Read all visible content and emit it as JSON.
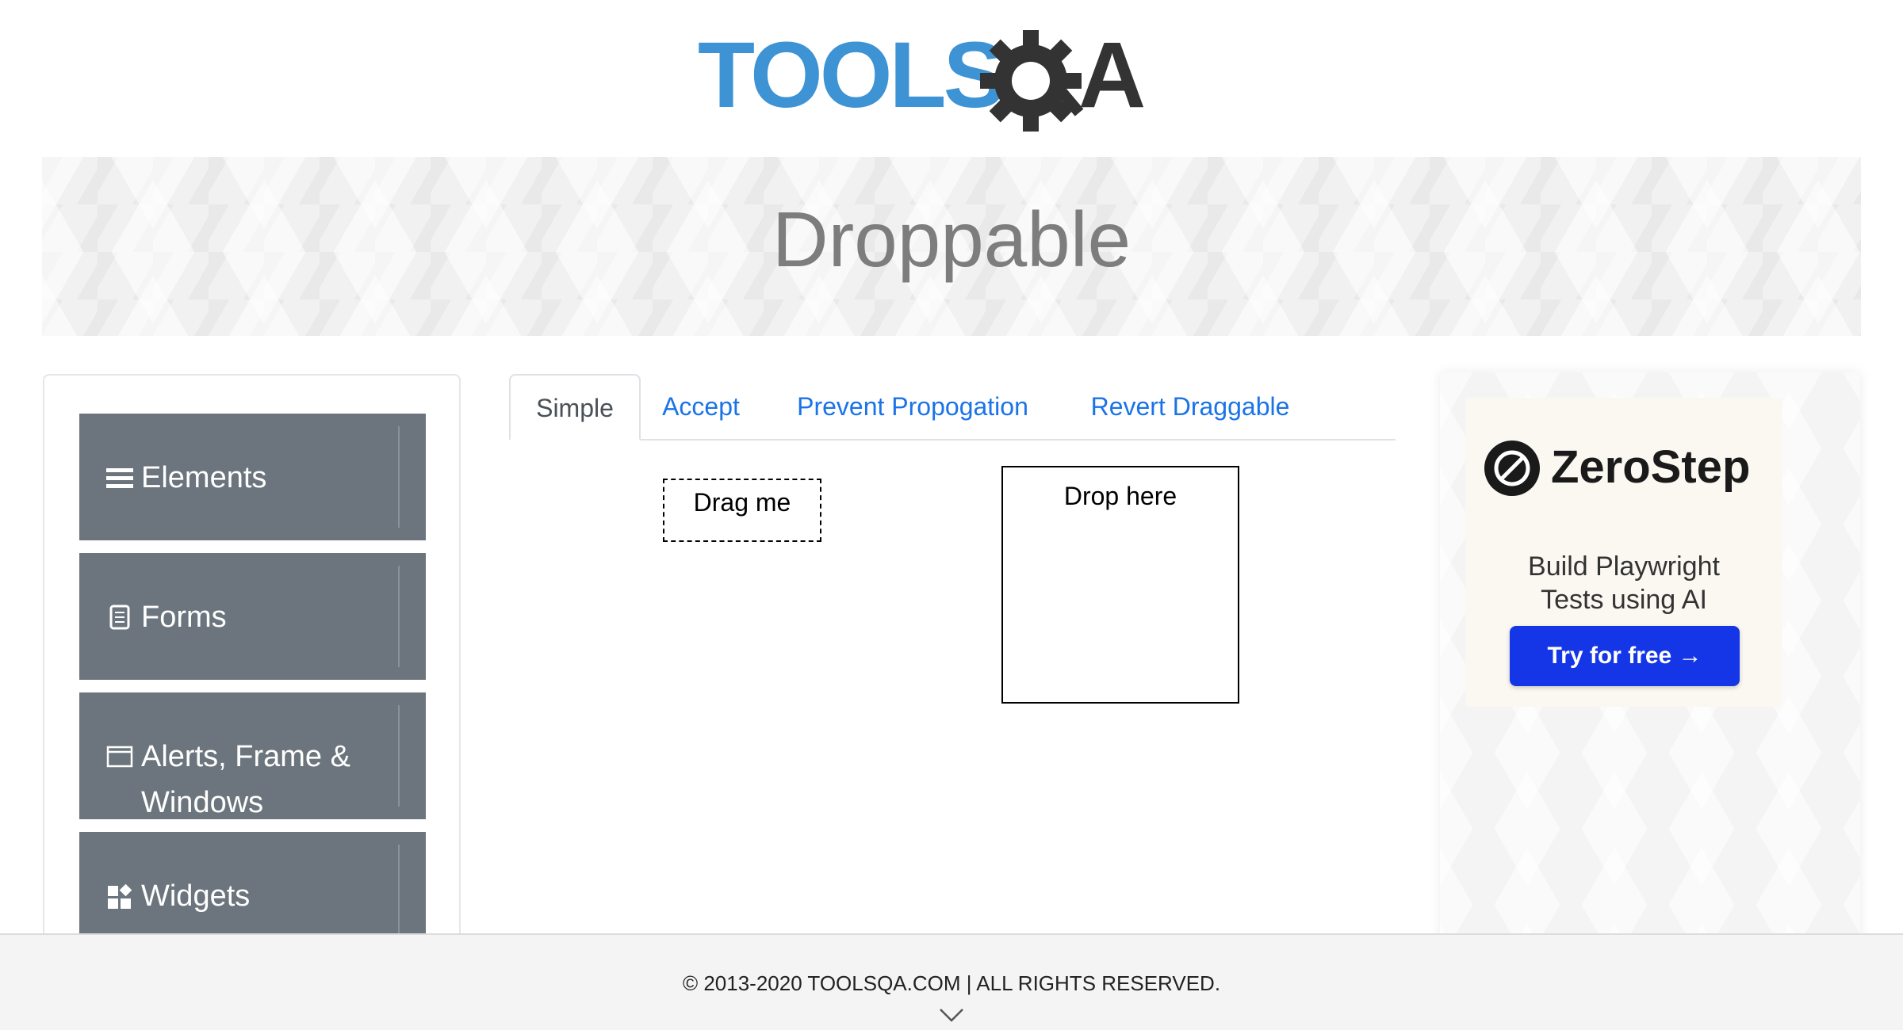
{
  "header": {
    "logo_text_1": "TOOLS",
    "logo_text_2": "QA"
  },
  "banner": {
    "title": "Droppable"
  },
  "sidebar": {
    "groups": [
      {
        "label": "Elements",
        "icon": "hamburger-icon"
      },
      {
        "label": "Forms",
        "icon": "form-icon"
      },
      {
        "label_line1": "Alerts, Frame &",
        "label_line2": "Windows",
        "icon": "window-icon"
      },
      {
        "label": "Widgets",
        "icon": "widgets-icon"
      }
    ],
    "expand_icon": "download-arrow-icon"
  },
  "tabs": [
    {
      "label": "Simple",
      "active": true
    },
    {
      "label": "Accept",
      "active": false
    },
    {
      "label": "Prevent Propogation",
      "active": false
    },
    {
      "label": "Revert Draggable",
      "active": false
    }
  ],
  "simple": {
    "drag_label": "Drag me",
    "drop_label": "Drop here"
  },
  "ad": {
    "brand": "ZeroStep",
    "text_line1": "Build Playwright",
    "text_line2": "Tests using AI",
    "button_label": "Try for free →"
  },
  "footer": {
    "text": "© 2013-2020 TOOLSQA.COM | ALL RIGHTS RESERVED."
  },
  "colors": {
    "logo_blue": "#3d93d4",
    "logo_dark": "#333333",
    "sidebar_group_bg": "#6c757d",
    "tab_link": "#1a73e8",
    "ad_button": "#1436e6"
  }
}
